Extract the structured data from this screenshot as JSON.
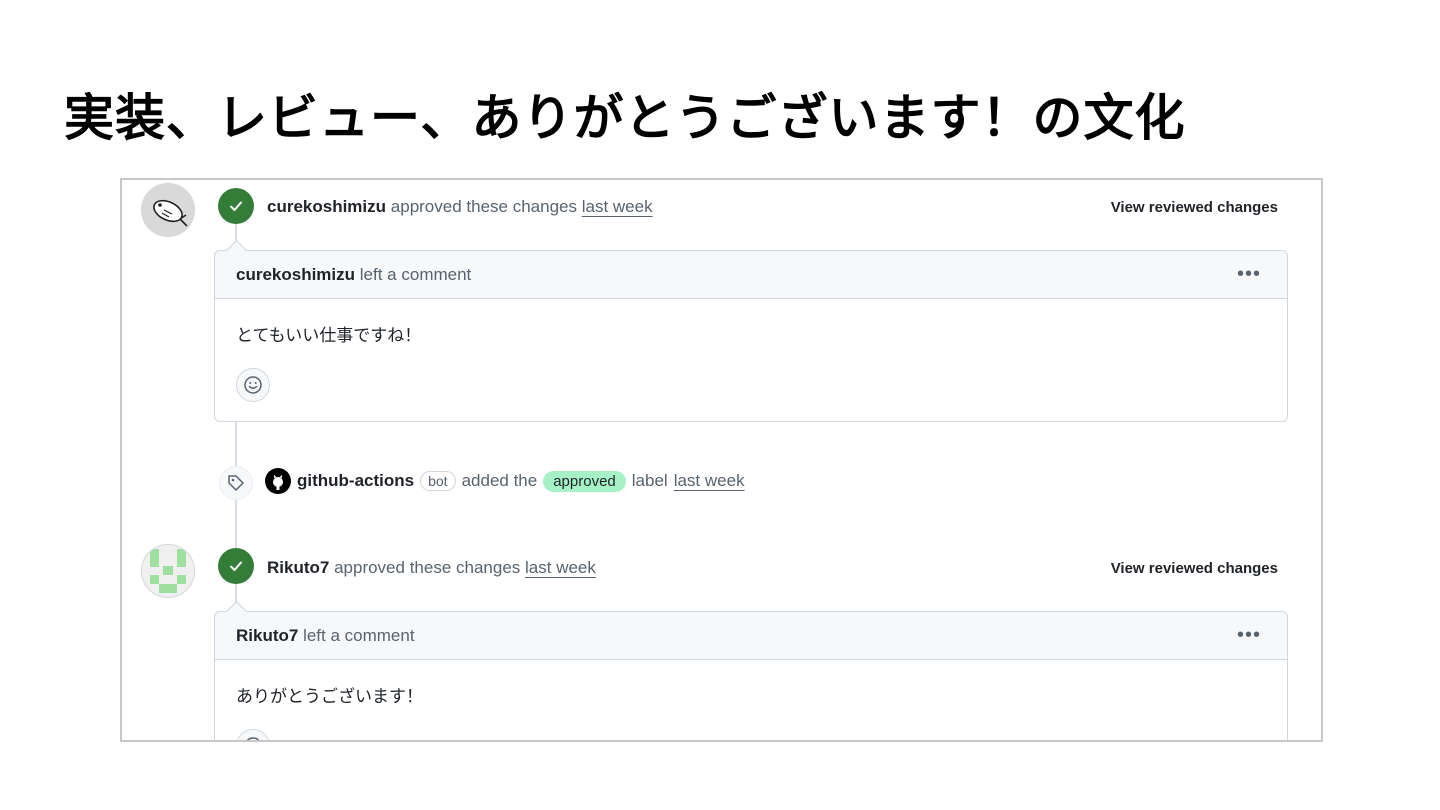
{
  "slide": {
    "title": "実装、レビュー、ありがとうございます！の文化"
  },
  "reviews": [
    {
      "user": "curekoshimizu",
      "action": "approved these changes",
      "time": "last week",
      "view_changes": "View reviewed changes",
      "comment_user": "curekoshimizu",
      "comment_action": "left a comment",
      "comment_body": "とてもいい仕事ですね！"
    },
    {
      "user": "Rikuto7",
      "action": "approved these changes",
      "time": "last week",
      "view_changes": "View reviewed changes",
      "comment_user": "Rikuto7",
      "comment_action": "left a comment",
      "comment_body": "ありがとうございます！"
    }
  ],
  "label_event": {
    "user": "github-actions",
    "bot_badge": "bot",
    "text_before": "added the",
    "label": "approved",
    "text_after": "label",
    "time": "last week"
  },
  "colors": {
    "approved_badge": "#347d39",
    "label_bg": "#a6f2c6",
    "timeline": "#d8dee4"
  },
  "icons": {
    "approved": "check-icon",
    "label_event": "tag-icon",
    "menu": "kebab-icon",
    "reaction": "smiley-icon"
  }
}
